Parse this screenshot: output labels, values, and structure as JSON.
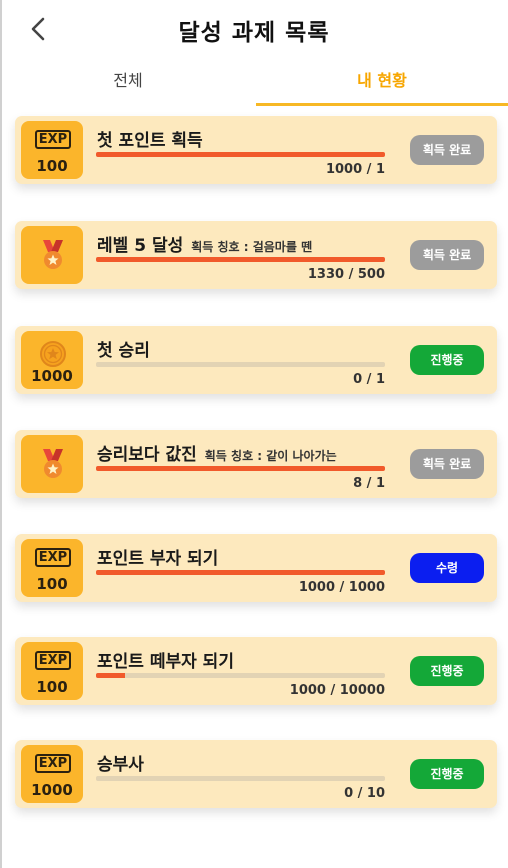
{
  "header": {
    "title": "달성 과제 목록",
    "back_icon": "chevron-left-icon"
  },
  "tabs": {
    "all": "전체",
    "mine": "내 현황",
    "active": "mine",
    "accent": "#f7b824"
  },
  "colors": {
    "card": "#fde9be",
    "badge": "#fbb52b",
    "progress": "#f15a2b",
    "done": "#9c9c9c",
    "in_progress": "#14a838",
    "claim": "#0b1ef0"
  },
  "achievements": [
    {
      "icon": "exp-icon",
      "reward": "100",
      "title": "첫 포인트 획득",
      "subtitle": "",
      "progress": 1.0,
      "count": "1000 / 1",
      "status": "획득 완료",
      "status_type": "done"
    },
    {
      "icon": "medal-icon",
      "reward": "",
      "title": "레벨 5 달성",
      "subtitle": "획득 칭호 : 걸음마를 뗀",
      "progress": 1.0,
      "count": "1330 / 500",
      "status": "획득 완료",
      "status_type": "done"
    },
    {
      "icon": "coin-icon",
      "reward": "1000",
      "title": "첫 승리",
      "subtitle": "",
      "progress": 0.0,
      "count": "0 / 1",
      "status": "진행중",
      "status_type": "progress"
    },
    {
      "icon": "medal-icon",
      "reward": "",
      "title": "승리보다 값진",
      "subtitle": "획득 칭호 : 같이 나아가는",
      "progress": 1.0,
      "count": "8 / 1",
      "status": "획득 완료",
      "status_type": "done"
    },
    {
      "icon": "exp-icon",
      "reward": "100",
      "title": "포인트 부자 되기",
      "subtitle": "",
      "progress": 1.0,
      "count": "1000 / 1000",
      "status": "수령",
      "status_type": "claim"
    },
    {
      "icon": "exp-icon",
      "reward": "100",
      "title": "포인트 떼부자 되기",
      "subtitle": "",
      "progress": 0.1,
      "count": "1000 / 10000",
      "status": "진행중",
      "status_type": "progress"
    },
    {
      "icon": "exp-icon",
      "reward": "1000",
      "title": "승부사",
      "subtitle": "",
      "progress": 0.0,
      "count": "0 / 10",
      "status": "진행중",
      "status_type": "progress"
    }
  ],
  "exp_label": "EXP"
}
